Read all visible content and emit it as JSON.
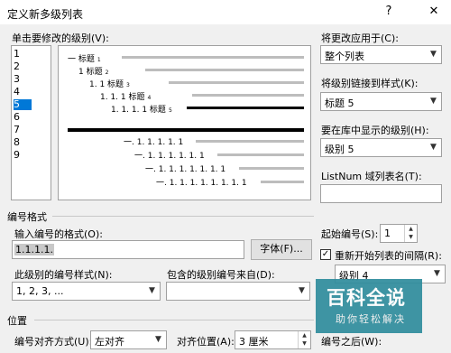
{
  "dialog": {
    "title": "定义新多级列表"
  },
  "titlebar": {
    "help_glyph": "?",
    "close_glyph": "✕"
  },
  "level_section": {
    "label": "单击要修改的级别(V):",
    "levels": [
      "1",
      "2",
      "3",
      "4",
      "5",
      "6",
      "7",
      "8",
      "9"
    ],
    "selected": "5"
  },
  "preview": {
    "rows": [
      {
        "text": "一 标题",
        "sub": "1"
      },
      {
        "text": "1 标题",
        "sub": "2"
      },
      {
        "text": "1. 1 标题",
        "sub": "3"
      },
      {
        "text": "1. 1. 1 标题",
        "sub": "4"
      },
      {
        "text": "1. 1. 1. 1 标题",
        "sub": "5"
      },
      {
        "text": "一. 1. 1. 1. 1. 1",
        "sub": ""
      },
      {
        "text": "一. 1. 1. 1. 1. 1. 1",
        "sub": ""
      },
      {
        "text": "一. 1. 1. 1. 1. 1. 1. 1",
        "sub": ""
      },
      {
        "text": "一. 1. 1. 1. 1. 1. 1. 1. 1",
        "sub": ""
      }
    ]
  },
  "right_panel": {
    "apply_to_label": "将更改应用于(C):",
    "apply_to_value": "整个列表",
    "link_style_label": "将级别链接到样式(K):",
    "link_style_value": "标题 5",
    "gallery_level_label": "要在库中显示的级别(H):",
    "gallery_level_value": "级别 5",
    "listnum_label": "ListNum 域列表名(T):",
    "listnum_value": ""
  },
  "number_format": {
    "section_label": "编号格式",
    "enter_format_label": "输入编号的格式(O):",
    "format_value": "1.1.1.1.",
    "font_button": "字体(F)...",
    "style_label": "此级别的编号样式(N):",
    "style_value": "1, 2, 3, ...",
    "include_from_label": "包含的级别编号来自(D):",
    "include_from_value": "",
    "start_at_label": "起始编号(S):",
    "start_at_value": "1",
    "restart_label": "重新开始列表的间隔(R):",
    "restart_checked": true,
    "restart_value": "级别 4"
  },
  "position": {
    "section_label": "位置",
    "alignment_label": "编号对齐方式(U):",
    "alignment_value": "左对齐",
    "aligned_at_label": "对齐位置(A):",
    "aligned_at_value": "3 厘米",
    "follow_label": "编号之后(W):"
  },
  "watermark": {
    "title": "百科全说",
    "subtitle": "助你轻松解决"
  },
  "colors": {
    "selection": "#0078d7",
    "watermark_bg": "#2f8d9d"
  }
}
